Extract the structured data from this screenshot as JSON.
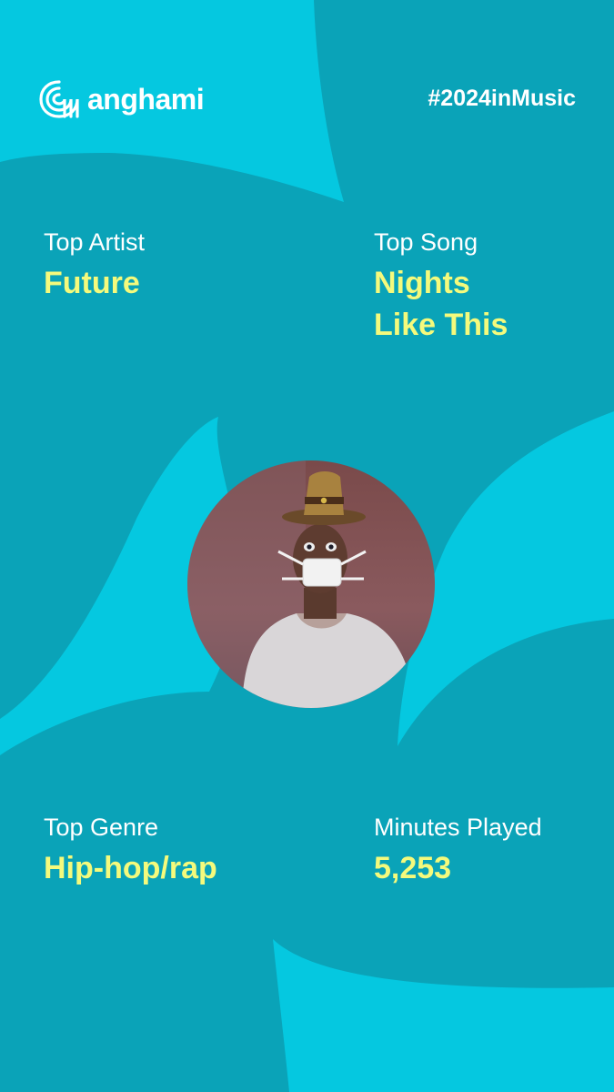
{
  "brand": {
    "name": "anghami",
    "hashtag": "#2024inMusic"
  },
  "stats": {
    "top_artist": {
      "label": "Top Artist",
      "value": "Future"
    },
    "top_song": {
      "label": "Top Song",
      "value_line1": "Nights",
      "value_line2": "Like This"
    },
    "top_genre": {
      "label": "Top Genre",
      "value": "Hip-hop/rap"
    },
    "minutes_played": {
      "label": "Minutes Played",
      "value": "5,253"
    }
  },
  "colors": {
    "background_dark": "#0aa3b8",
    "background_light": "#05c8e0",
    "label_text": "#ffffff",
    "value_text": "#f4fa7c"
  },
  "icons": {
    "logo": "anghami-logo-icon"
  }
}
